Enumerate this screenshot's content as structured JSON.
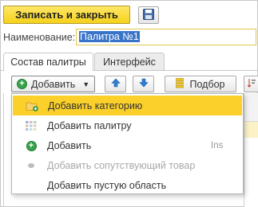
{
  "toolbar": {
    "save_close_label": "Записать и закрыть",
    "save_icon": "floppy-disk-icon"
  },
  "name_field": {
    "label": "Наименование:",
    "value": "Палитра №1"
  },
  "tabs": [
    {
      "label": "Состав палитры",
      "active": true
    },
    {
      "label": "Интерфейс",
      "active": false
    }
  ],
  "list_toolbar": {
    "add_label": "Добавить",
    "add_icon": "green-plus-circle-icon",
    "up_icon": "arrow-up-icon",
    "down_icon": "arrow-down-icon",
    "pick_label": "Подбор",
    "pick_icon": "stack-icon"
  },
  "add_menu": {
    "items": [
      {
        "label": "Добавить категорию",
        "icon": "folder-add-icon",
        "shortcut": "",
        "highlighted": true,
        "disabled": false
      },
      {
        "label": "Добавить палитру",
        "icon": "palette-grid-icon",
        "shortcut": "",
        "highlighted": false,
        "disabled": false
      },
      {
        "label": "Добавить",
        "icon": "green-plus-circle-icon",
        "shortcut": "Ins",
        "highlighted": false,
        "disabled": false
      },
      {
        "label": "Добавить сопутствующий товар",
        "icon": "gray-dot-icon",
        "shortcut": "",
        "highlighted": false,
        "disabled": true
      },
      {
        "label": "Добавить пустую область",
        "icon": "",
        "shortcut": "",
        "highlighted": false,
        "disabled": false
      }
    ]
  },
  "colors": {
    "primary_button": "#f5d21b",
    "highlight": "#fbd02a",
    "selection": "#3a74c8",
    "accent_blue": "#2f7fd6",
    "green": "#37a349"
  }
}
